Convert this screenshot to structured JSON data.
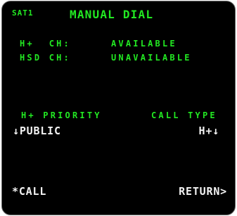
{
  "header": {
    "page_id": "SAT1",
    "title": "MANUAL DIAL"
  },
  "channels": [
    {
      "label": "H+  CH:",
      "status": "AVAILABLE"
    },
    {
      "label": "HSD CH:",
      "status": "UNAVAILABLE"
    }
  ],
  "priority": {
    "header": "H+ PRIORITY",
    "value": "↓PUBLIC"
  },
  "call_type": {
    "header": "CALL TYPE",
    "value": "H+↓"
  },
  "soft_keys": {
    "call": "*CALL",
    "return": "RETURN>"
  },
  "colors": {
    "screen": "#000000",
    "label_green": "#22e822",
    "data_white": "#f2f2f2"
  }
}
